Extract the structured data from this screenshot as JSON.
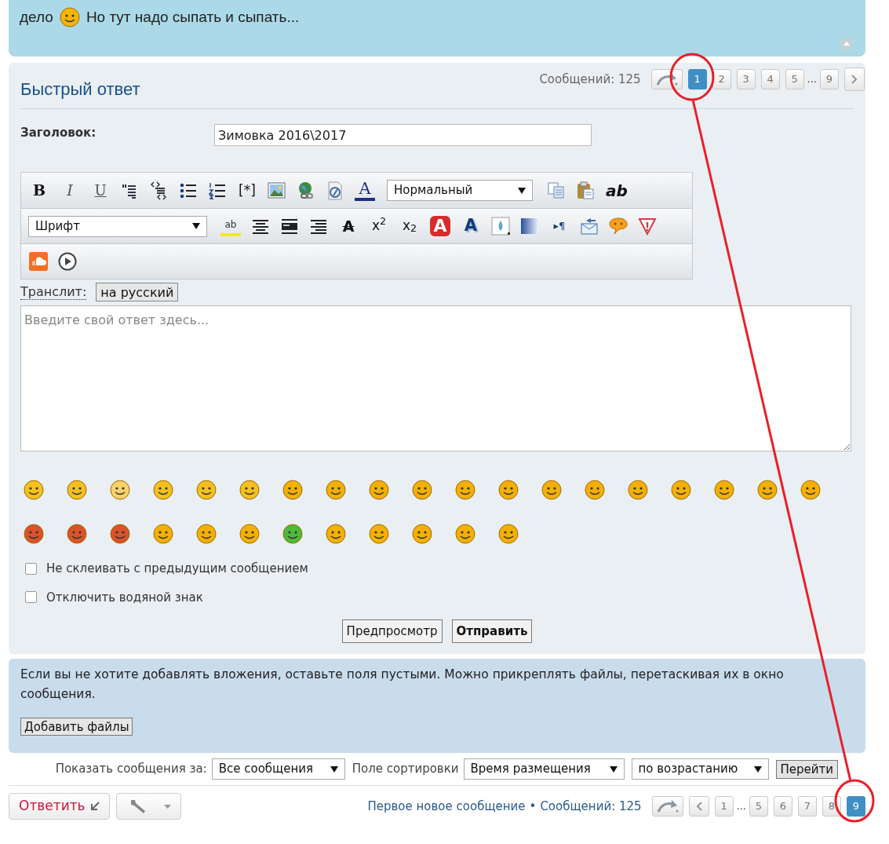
{
  "post": {
    "text_before": "дело",
    "text_after": "Но тут надо сыпать и сыпать..."
  },
  "quick_reply": {
    "title": "Быстрый ответ",
    "count": "Сообщений: 125",
    "pages": [
      {
        "kind": "page",
        "label": "1",
        "selected": true
      },
      {
        "kind": "page",
        "label": "2",
        "selected": false
      },
      {
        "kind": "page",
        "label": "3",
        "selected": false
      },
      {
        "kind": "page",
        "label": "4",
        "selected": false
      },
      {
        "kind": "page",
        "label": "5",
        "selected": false
      },
      {
        "kind": "ellipsis",
        "label": "..."
      },
      {
        "kind": "page",
        "label": "9",
        "selected": false
      }
    ],
    "subject_label": "Заголовок:",
    "subject_value": "Зимовка 2016\\2017",
    "toolbar": [
      [
        {
          "kind": "bold",
          "text": "B"
        },
        {
          "kind": "italic",
          "text": "I"
        },
        {
          "kind": "underline",
          "text": "U"
        },
        {
          "kind": "icon"
        },
        {
          "kind": "icon"
        },
        {
          "kind": "icon"
        },
        {
          "kind": "icon"
        },
        {
          "kind": "glyph",
          "text": "[*]"
        },
        {
          "kind": "icon"
        },
        {
          "kind": "icon"
        },
        {
          "kind": "icon"
        },
        {
          "kind": "fontcolor",
          "text": "A"
        },
        {
          "kind": "select",
          "text": "Нормальный"
        },
        {
          "kind": "icon"
        },
        {
          "kind": "icon"
        },
        {
          "kind": "bolditalic",
          "text": "ab"
        }
      ],
      [
        {
          "kind": "select",
          "text": "Шрифт"
        },
        {
          "kind": "highlight",
          "text": "ab"
        },
        {
          "kind": "icon"
        },
        {
          "kind": "icon"
        },
        {
          "kind": "icon"
        },
        {
          "kind": "strike",
          "text": "A"
        },
        {
          "kind": "glyph",
          "text": "x$^{2}$"
        },
        {
          "kind": "glyph",
          "text": "x$_{2}$"
        },
        {
          "kind": "outline",
          "text": "A"
        },
        {
          "kind": "shadow",
          "text": "A"
        },
        {
          "kind": "icon"
        },
        {
          "kind": "icon"
        },
        {
          "kind": "small",
          "text": "▸¶"
        },
        {
          "kind": "icon"
        },
        {
          "kind": "icon"
        },
        {
          "kind": "icon"
        }
      ],
      [
        {
          "kind": "icon"
        },
        {
          "kind": "icon"
        }
      ]
    ],
    "translit_label": "Транслит:",
    "translit_button": "на русский",
    "message_placeholder": "Введите свой ответ здесь...",
    "options": [
      {
        "label": "Не склеивать с предыдущим сообщением",
        "checked": false
      },
      {
        "label": "Отключить водяной знак",
        "checked": false
      }
    ],
    "buttons": [
      {
        "label": "Предпросмотр",
        "kind": "normal"
      },
      {
        "label": "Отправить",
        "kind": "primary"
      }
    ]
  },
  "attachments": {
    "text": "Если вы не хотите добавлять вложения, оставьте поля пустыми. Можно прикреплять файлы, перетаскивая их в окно сообщения.",
    "button": "Добавить файлы"
  },
  "sorting": {
    "show_label": "Показать сообщения за:",
    "show_value": "Все сообщения",
    "sort_label": "Поле сортировки",
    "sort_value": "Время размещения",
    "order_value": "по возрастанию",
    "go_button": "Перейти"
  },
  "footer": {
    "reply_button": "Ответить",
    "first_new_link": "Первое новое сообщение",
    "separator": "•",
    "count": "Сообщений: 125",
    "pages": [
      {
        "kind": "prev"
      },
      {
        "kind": "page",
        "label": "1",
        "selected": false
      },
      {
        "kind": "ellipsis",
        "label": "..."
      },
      {
        "kind": "page",
        "label": "5",
        "selected": false
      },
      {
        "kind": "page",
        "label": "6",
        "selected": false
      },
      {
        "kind": "page",
        "label": "7",
        "selected": false
      },
      {
        "kind": "page",
        "label": "8",
        "selected": false
      },
      {
        "kind": "page",
        "label": "9",
        "selected": true
      }
    ]
  }
}
